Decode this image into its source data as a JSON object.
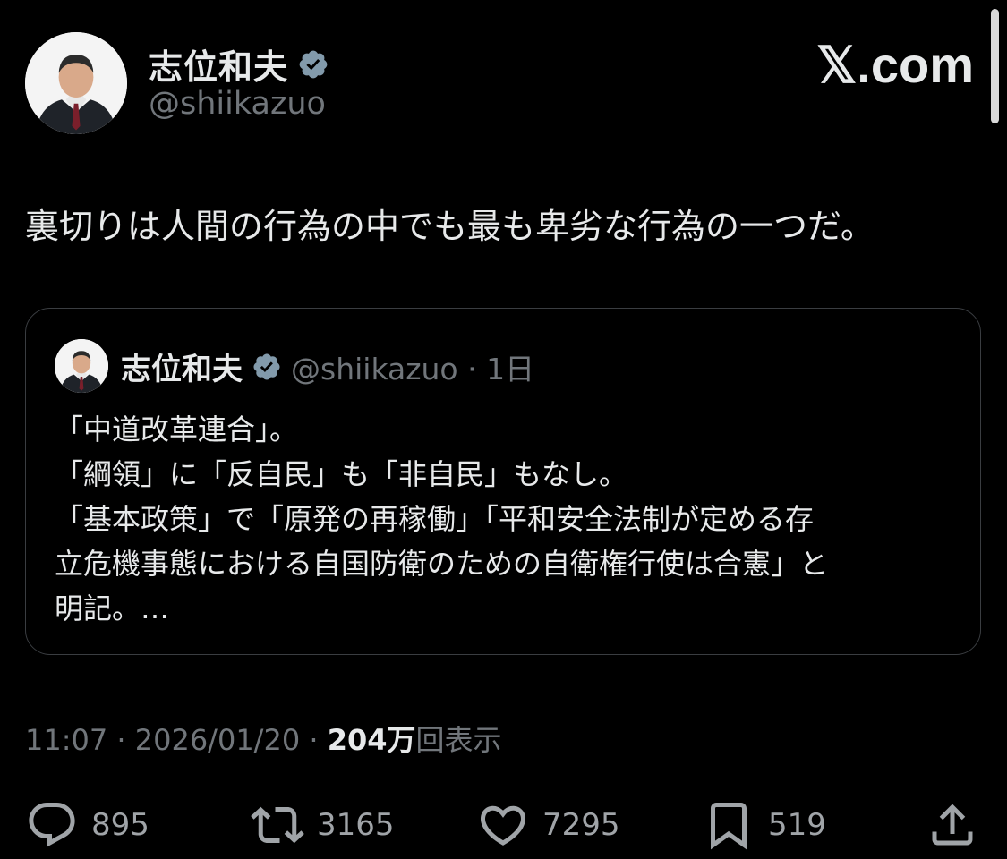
{
  "author": {
    "name": "志位和夫",
    "handle": "@shiikazuo",
    "verified": true
  },
  "brand": "𝕏.com",
  "tweet": {
    "text": "裏切りは人間の行為の中でも最も卑劣な行為の一つだ。",
    "timestamp": "11:07 · 2026/01/20 · ",
    "views_count": "204万",
    "views_label": "回表示"
  },
  "quote": {
    "name": "志位和夫",
    "meta": "@shiikazuo · 1日",
    "text": "「中道改革連合」。\n「綱領」に「反自民」も「非自民」もなし。\n「基本政策」で「原発の再稼働」「平和安全法制が定める存\n立危機事態における自国防衛のための自衛権行使は合憲」と\n明記。…"
  },
  "actions": {
    "reply_count": "895",
    "retweet_count": "3165",
    "like_count": "7295",
    "bookmark_count": "519"
  },
  "colors": {
    "background": "#000000",
    "text": "#e7e9ea",
    "secondary": "#71767b",
    "verified_badge": "#829aab"
  },
  "icons": [
    "verified-icon",
    "reply-icon",
    "retweet-icon",
    "like-icon",
    "bookmark-icon",
    "share-icon"
  ]
}
